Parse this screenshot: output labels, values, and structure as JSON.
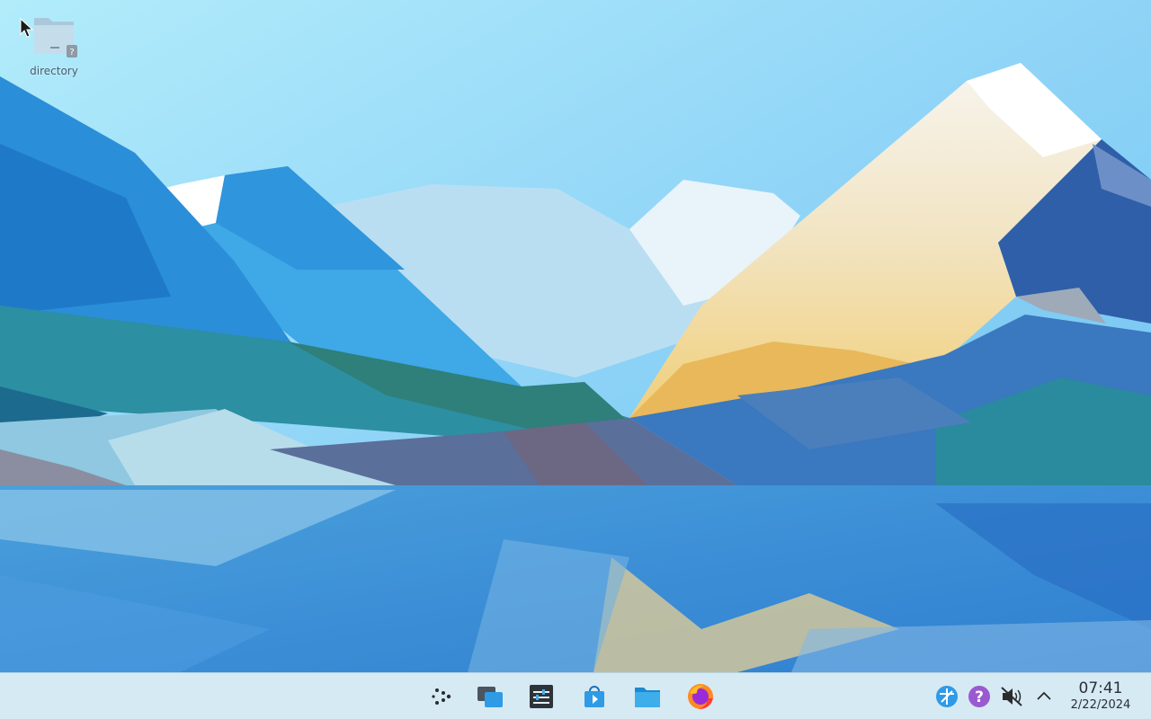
{
  "desktop": {
    "wallpaper": "kde-plasma-polygonal-mountains",
    "icons": [
      {
        "label": "directory",
        "icon": "folder-unknown-icon"
      }
    ]
  },
  "taskbar": {
    "background": "#d6eaf4",
    "launchers": [
      {
        "name": "application-launcher",
        "icon": "kde-launcher-icon"
      },
      {
        "name": "virtual-desktops",
        "icon": "desktop-switcher-icon"
      },
      {
        "name": "system-settings",
        "icon": "settings-sliders-icon"
      },
      {
        "name": "discover-store",
        "icon": "store-bag-icon"
      },
      {
        "name": "dolphin-file-manager",
        "icon": "folder-icon"
      },
      {
        "name": "firefox",
        "icon": "firefox-icon"
      }
    ],
    "tray": [
      {
        "name": "network",
        "icon": "network-globe-icon"
      },
      {
        "name": "help",
        "icon": "help-question-icon"
      },
      {
        "name": "volume",
        "icon": "volume-muted-icon"
      },
      {
        "name": "show-hidden",
        "icon": "chevron-up-icon"
      }
    ],
    "clock": {
      "time": "07:41",
      "date": "2/22/2024"
    }
  }
}
